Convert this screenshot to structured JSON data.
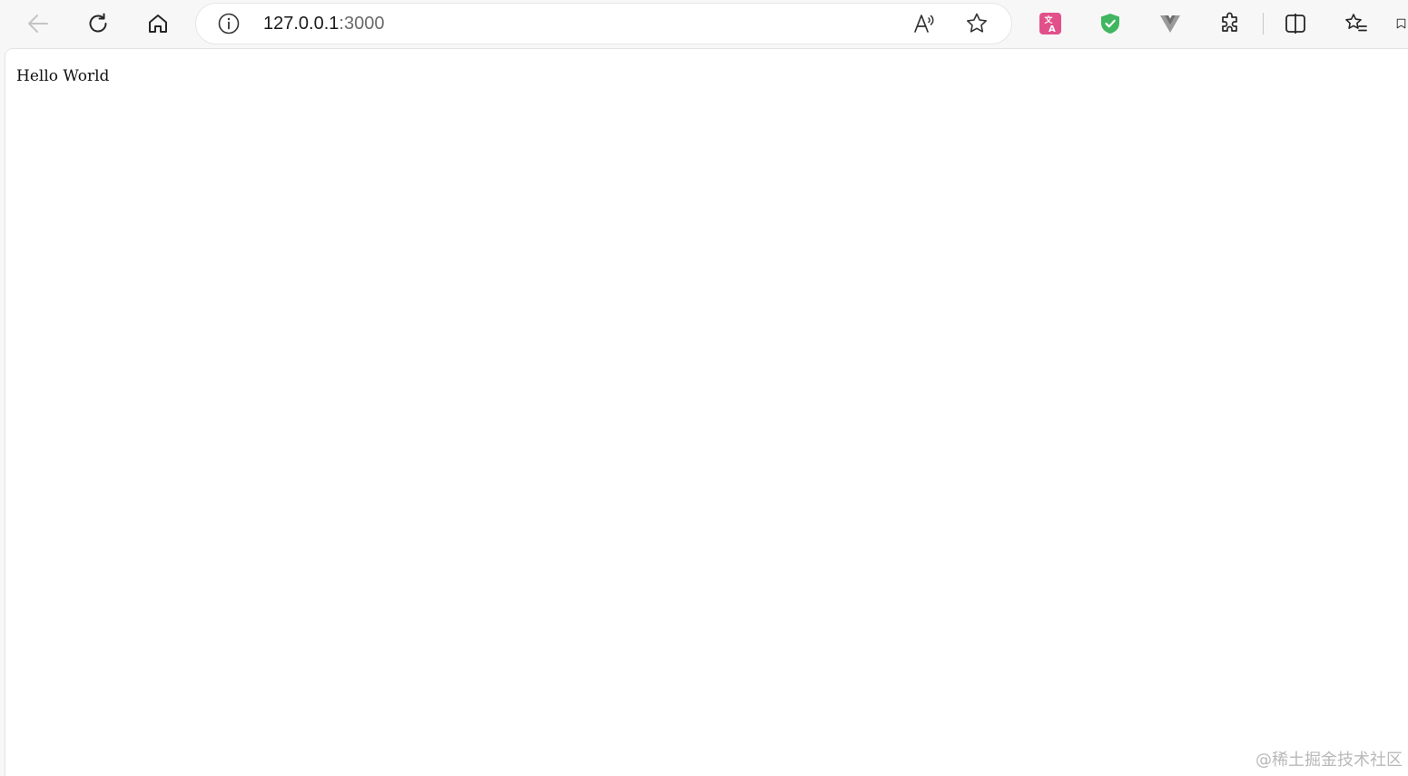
{
  "browser": {
    "url_host": "127.0.0.1",
    "url_port": ":3000",
    "icons": {
      "back": "arrow-left-icon",
      "refresh": "refresh-icon",
      "home": "home-icon",
      "site_info": "info-icon",
      "read_aloud": "read-aloud-icon",
      "favorite": "star-icon",
      "translate_ext": "translate-extension-icon",
      "shield_ext": "shield-check-extension-icon",
      "vue_ext": "vue-devtools-extension-icon",
      "extensions": "puzzle-icon",
      "split_screen": "split-screen-icon",
      "favorites": "favorites-list-icon"
    },
    "colors": {
      "translate_ext": "#e2508a",
      "shield_ext": "#3fb65f",
      "vue_ext": "#9a9a9a"
    }
  },
  "page": {
    "text": "Hello World"
  },
  "watermark": "@稀土掘金技术社区"
}
